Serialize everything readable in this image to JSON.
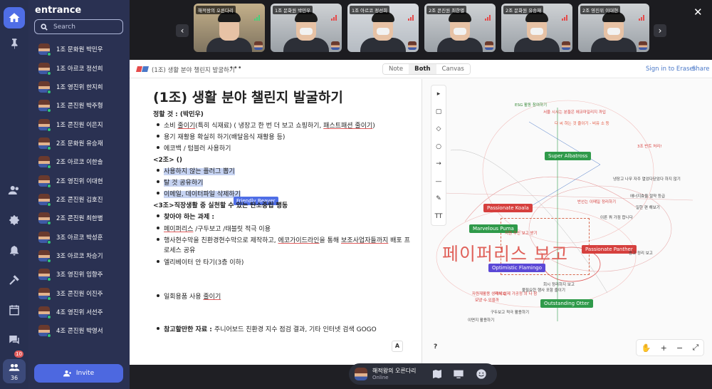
{
  "sidebar": {
    "title": "entrance",
    "search_placeholder": "Search",
    "members": [
      "1조 문화원 박민우",
      "1조 아르코 정선희",
      "1조 영진위 한지희",
      "1조 콘진원 박주형",
      "1조 콘진원 이은지",
      "2조 문화원 유승재",
      "2조 아르코 이한솔",
      "2조 영진위 이대현",
      "2조 콘진원 김호진",
      "2조 콘진원 최한별",
      "3조 아르코 박성훈",
      "3조 아르코 차승기",
      "3조 영진위 임향주",
      "3조 콘진원 이진주",
      "4조 영진위 서선주",
      "4조 콘진원 박영서"
    ],
    "invite_label": "Invite"
  },
  "rail": {
    "badge": "10",
    "online_count": "36",
    "icons": [
      "home-icon",
      "pin-icon",
      "members-icon",
      "settings-icon",
      "bell-icon",
      "hammer-icon",
      "calendar-icon",
      "chat-icon",
      "people-icon"
    ]
  },
  "videos": [
    {
      "label": "해적왕의 오른다리",
      "signal": "green"
    },
    {
      "label": "1조 문화원 박민우",
      "signal": "red"
    },
    {
      "label": "1조 아르코 정선희",
      "signal": "red"
    },
    {
      "label": "2조 콘진원 최한별",
      "signal": "red"
    },
    {
      "label": "2조 문화원 유승재",
      "signal": "red"
    },
    {
      "label": "2조 영진위 이대현",
      "signal": "red"
    }
  ],
  "app": {
    "doc_title": "(1조) 생활 분야 챌린지 발굴하기",
    "more": "•••",
    "tabs": [
      "Note",
      "Both",
      "Canvas"
    ],
    "active_tab": "Both",
    "signin": "Sign in to Eraser",
    "share": "Share"
  },
  "doc": {
    "heading": "(1조) 생활 분야 챌린지 발굴하기",
    "l1": "정할 것 : (박민우)",
    "b1a": "소비 ",
    "b1b": "줄이기",
    "b1c": "(특히 식재료) ( 냉장고 한 번 더 보고 쇼핑하기, ",
    "b1d": "패스트패션 줄이기",
    "b1e": ")",
    "b2": "용기 재활용 확실히 하기(배달음식 재활용 등)",
    "b3": "에코백 / 텀블러 사용하기",
    "l2": "<2조> ()",
    "b4": "사용하지 않는 플러그 뽑기",
    "b5": "탈 것 공유하기",
    "b6": "이메일, 데이터파일 삭제하기",
    "cursor": "Friendly Beaver",
    "l3": "<3조>직장생활 중  실천할 수 있는 탄소중립 행동",
    "b7": "찾아야 하는 과제  :",
    "b8a": "페이퍼리스",
    "b8b": " /구두보고 /태블릿 적극 이용",
    "b9a": "행사현수막을 친환경현수막으로 제작하고, ",
    "b9b": "에코가이드라인",
    "b9c": "을 통해 ",
    "b9d": "보조사업자들까지",
    "b9e": " 배포 프",
    "b9f": "로세스 공유",
    "b10": "엘리베이터 안 타기(3층 이하)",
    "b11a": "일회용품 사용 ",
    "b11b": "줄이기",
    "l4a": "참고할만한 자료 : ",
    "l4b": "주니어보드 친환경 지수 점검 결과, 기타 인터넷 검색 GOGO",
    "format_btn": "A"
  },
  "canvas": {
    "tools": [
      "▸",
      "▢",
      "◇",
      "○",
      "→",
      "—",
      "✎",
      "TT"
    ],
    "help": "?",
    "zoom": [
      "✋",
      "+",
      "−",
      "⤢"
    ],
    "tags": [
      {
        "text": "Super Albatross",
        "color": "#2f9a4a"
      },
      {
        "text": "Passionate Koala",
        "color": "#d6403e"
      },
      {
        "text": "Marvelous Puma",
        "color": "#2f9a4a"
      },
      {
        "text": "Passionate Panther",
        "color": "#d6403e"
      },
      {
        "text": "Optimistic Flamingo",
        "color": "#5b48d6"
      },
      {
        "text": "Outstanding Otter",
        "color": "#2f9a4a"
      }
    ],
    "big_text": "페이퍼리스 보고",
    "notes": [
      "ESG 활동 참여하기",
      "서울 시시는 분들은 에코마일리지 까입",
      "다 씨 하는 것 줄이기 - 비유 소 등",
      "3조 반트 처리!",
      "지원 주민 보고 받기",
      "구두보고 적극 활용하기",
      "이면지 활용하기",
      "불필요한 행사 포함 줄이기",
      "패시 설제 가공정 의 다 참",
      "냉장고 나무 자주 열었다닫았다 하지 않기",
      "에너지효율 절약 등급",
      "자원재활용 생각해보",
      "보냈 수 있을까",
      "일한 편 해보기",
      "중고 정리 보고",
      "이른 꿔 가점 합니다",
      "반선는 이메일 정리하기",
      "회시 정리하지 보고"
    ],
    "note_colors": [
      "#3a8a3a",
      "#d6403e",
      "#e2523b",
      "#d6403e",
      "#d6403e",
      "#444",
      "#444",
      "#444",
      "#d6403e",
      "#444",
      "#444",
      "#d6403e",
      "#d6403e",
      "#444",
      "#444",
      "#444",
      "#d6403e",
      "#444"
    ]
  },
  "bottombar": {
    "name": "해적왕의 오른다리",
    "status": "Online"
  }
}
